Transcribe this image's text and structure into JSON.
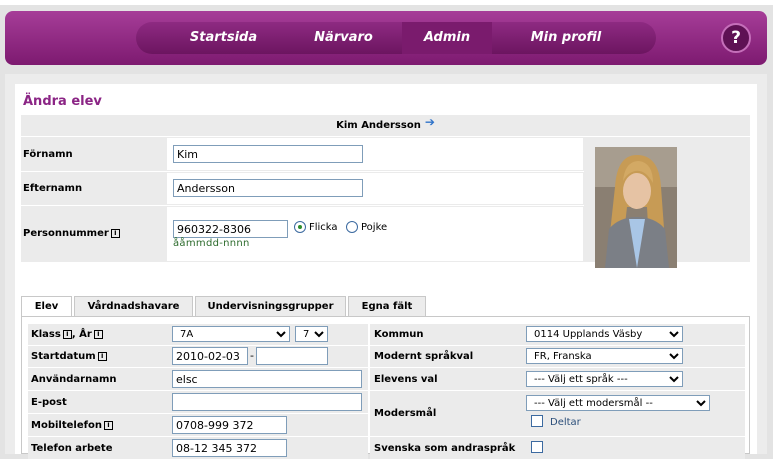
{
  "nav": {
    "items": [
      "Startsida",
      "Närvaro",
      "Admin",
      "Min profil"
    ],
    "active": "Admin",
    "help_label": "?"
  },
  "page": {
    "title": "Ändra elev",
    "student_name": "Kim Andersson"
  },
  "person": {
    "firstname_label": "Förnamn",
    "firstname_value": "Kim",
    "lastname_label": "Efternamn",
    "lastname_value": "Andersson",
    "pnr_label": "Personnummer",
    "pnr_value": "960322-8306",
    "pnr_hint": "ååmmdd-nnnn",
    "gender_girl": "Flicka",
    "gender_boy": "Pojke",
    "gender_selected": "Flicka"
  },
  "tabs": [
    "Elev",
    "Vårdnadshavare",
    "Undervisningsgrupper",
    "Egna fält"
  ],
  "form_left": {
    "class_label": "Klass",
    "year_label": "År",
    "class_value": "7A",
    "year_value": "7",
    "startdate_label": "Startdatum",
    "startdate_value": "2010-02-03",
    "startdate_sep": "-",
    "username_label": "Användarnamn",
    "username_value": "elsc",
    "email_label": "E-post",
    "email_value": "",
    "mobile_label": "Mobiltelefon",
    "mobile_value": "0708-999 372",
    "workphone_label": "Telefon arbete",
    "workphone_value": "08-12 345 372"
  },
  "form_right": {
    "municipality_label": "Kommun",
    "municipality_value": "0114 Upplands Väsby",
    "modlang_label": "Modernt språkval",
    "modlang_value": "FR, Franska",
    "studentchoice_label": "Elevens val",
    "studentchoice_value": "--- Välj ett språk ---",
    "mothertongue_label": "Modersmål",
    "mothertongue_value": "--- Välj ett modersmål --",
    "participates_label": "Deltar",
    "sva_label": "Svenska som andraspråk"
  }
}
